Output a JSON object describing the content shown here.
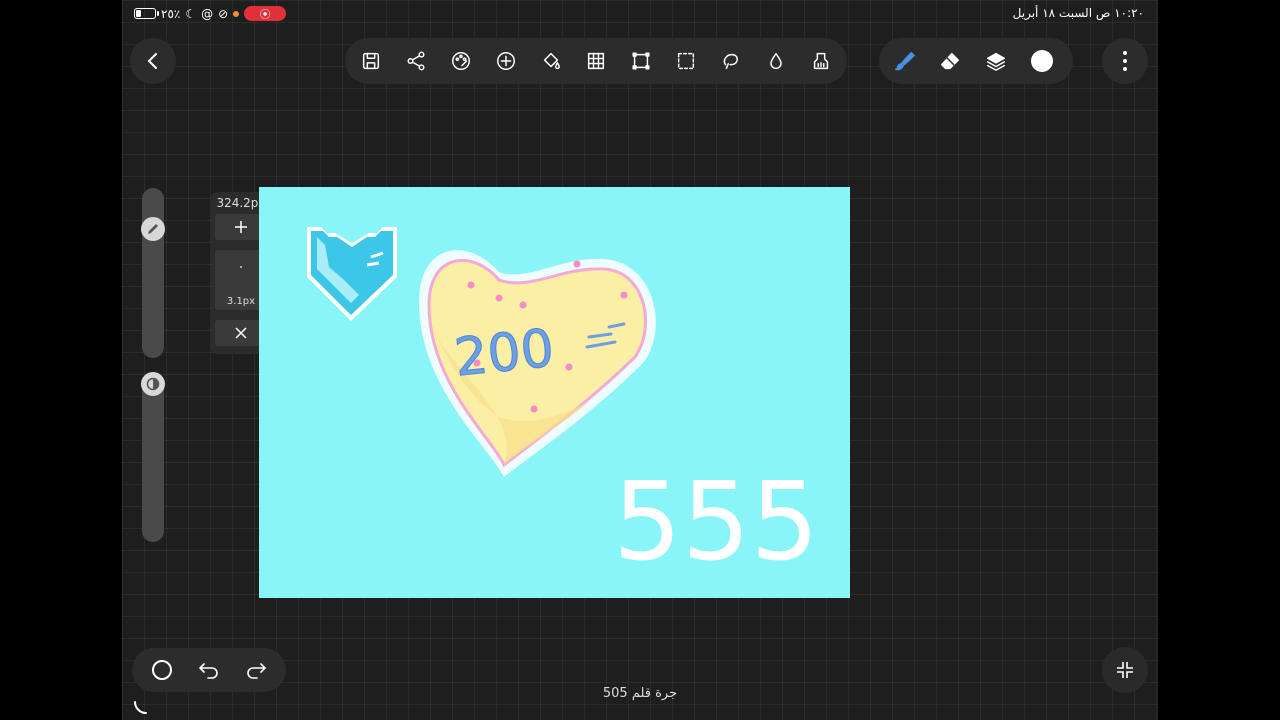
{
  "status_bar": {
    "battery_text": "٢٥٪",
    "battery_level": 0.25,
    "datetime": "١٠:٢٠ ص   السبت ١٨ أبريل"
  },
  "toolbar": {
    "left_tools": [
      "save-icon",
      "share-icon",
      "palette-icon",
      "add-icon",
      "fill-bucket-icon",
      "grid-icon",
      "transform-icon",
      "selection-icon",
      "lasso-icon",
      "blur-icon",
      "smudge-icon"
    ],
    "right_tools": [
      "brush-icon",
      "eraser-icon",
      "layers-icon",
      "color-icon"
    ],
    "accent": "#4a90e2"
  },
  "brush_popup": {
    "size_label": "324.2px",
    "min_label": "3.1px"
  },
  "canvas": {
    "background": "#8af5f9",
    "heart_text": "200",
    "number_text": "555"
  },
  "bottom": {
    "stroke_count": "505 جرة قلم"
  }
}
